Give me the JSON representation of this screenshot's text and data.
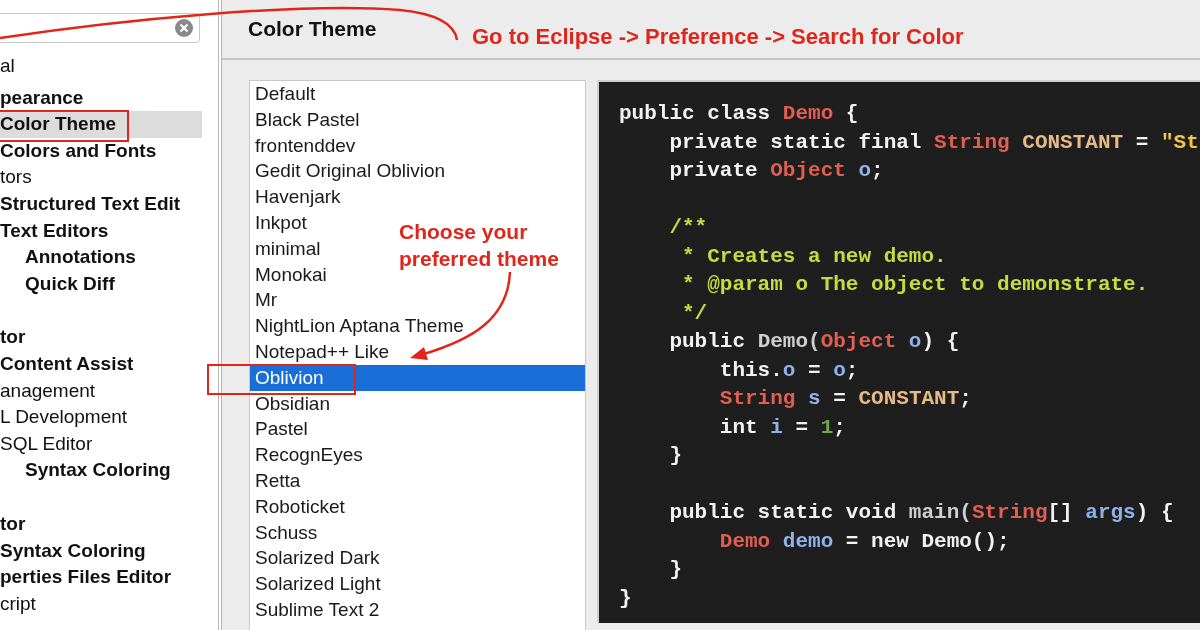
{
  "sidebar": {
    "sections": [
      {
        "items": [
          {
            "label": "al",
            "bold": false,
            "indented": false,
            "selected": false
          }
        ]
      },
      {
        "items": [
          {
            "label": "pearance",
            "bold": true,
            "indented": false,
            "selected": false
          },
          {
            "label": "Color Theme",
            "bold": true,
            "indented": false,
            "selected": true
          },
          {
            "label": "Colors and Fonts",
            "bold": true,
            "indented": false,
            "selected": false
          },
          {
            "label": "tors",
            "bold": false,
            "indented": false,
            "selected": false
          },
          {
            "label": "Structured Text Edit",
            "bold": true,
            "indented": false,
            "selected": false
          },
          {
            "label": "Text Editors",
            "bold": true,
            "indented": false,
            "selected": false
          },
          {
            "label": "Annotations",
            "bold": true,
            "indented": true,
            "selected": false
          },
          {
            "label": "Quick Diff",
            "bold": true,
            "indented": true,
            "selected": false
          }
        ]
      },
      {
        "items": [
          {
            "label": "tor",
            "bold": true,
            "indented": false,
            "selected": false
          },
          {
            "label": "Content Assist",
            "bold": true,
            "indented": false,
            "selected": false
          },
          {
            "label": "anagement",
            "bold": false,
            "indented": false,
            "selected": false
          },
          {
            "label": "L Development",
            "bold": false,
            "indented": false,
            "selected": false
          },
          {
            "label": "SQL Editor",
            "bold": false,
            "indented": false,
            "selected": false
          },
          {
            "label": "Syntax Coloring",
            "bold": true,
            "indented": true,
            "selected": false
          }
        ]
      },
      {
        "items": [
          {
            "label": "tor",
            "bold": true,
            "indented": false,
            "selected": false
          },
          {
            "label": "Syntax Coloring",
            "bold": true,
            "indented": false,
            "selected": false
          },
          {
            "label": "perties Files Editor",
            "bold": true,
            "indented": false,
            "selected": false
          },
          {
            "label": "cript",
            "bold": false,
            "indented": false,
            "selected": false
          }
        ]
      }
    ]
  },
  "page_title": "Color Theme",
  "themes": [
    {
      "label": "Default",
      "selected": false
    },
    {
      "label": "Black Pastel",
      "selected": false
    },
    {
      "label": "frontenddev",
      "selected": false
    },
    {
      "label": "Gedit Original Oblivion",
      "selected": false
    },
    {
      "label": "Havenjark",
      "selected": false
    },
    {
      "label": "Inkpot",
      "selected": false
    },
    {
      "label": "minimal",
      "selected": false
    },
    {
      "label": "Monokai",
      "selected": false
    },
    {
      "label": "Mr",
      "selected": false
    },
    {
      "label": "NightLion Aptana Theme",
      "selected": false
    },
    {
      "label": "Notepad++ Like",
      "selected": false
    },
    {
      "label": "Oblivion",
      "selected": true
    },
    {
      "label": "Obsidian",
      "selected": false
    },
    {
      "label": "Pastel",
      "selected": false
    },
    {
      "label": "RecognEyes",
      "selected": false
    },
    {
      "label": "Retta",
      "selected": false
    },
    {
      "label": "Roboticket",
      "selected": false
    },
    {
      "label": "Schuss",
      "selected": false
    },
    {
      "label": "Solarized Dark",
      "selected": false
    },
    {
      "label": "Solarized Light",
      "selected": false
    },
    {
      "label": "Sublime Text 2",
      "selected": false
    }
  ],
  "code_preview": [
    {
      "kind": "code",
      "tokens": [
        {
          "kind": "keyword",
          "text": "public class "
        },
        {
          "kind": "type",
          "text": "Demo"
        },
        {
          "kind": "keyword",
          "text": " {"
        }
      ]
    },
    {
      "kind": "code",
      "tokens": [
        {
          "kind": "keyword",
          "text": "    private static final "
        },
        {
          "kind": "type",
          "text": "String"
        },
        {
          "kind": "constant",
          "text": " CONSTANT"
        },
        {
          "kind": "keyword",
          "text": " = "
        },
        {
          "kind": "string",
          "text": "\"St"
        }
      ]
    },
    {
      "kind": "code",
      "tokens": [
        {
          "kind": "keyword",
          "text": "    private "
        },
        {
          "kind": "type",
          "text": "Object"
        },
        {
          "kind": "variable",
          "text": " o"
        },
        {
          "kind": "keyword",
          "text": ";"
        }
      ]
    },
    {
      "kind": "blank"
    },
    {
      "kind": "code",
      "tokens": [
        {
          "kind": "comment",
          "text": "    /**"
        }
      ]
    },
    {
      "kind": "code",
      "tokens": [
        {
          "kind": "comment",
          "text": "     * Creates a new demo."
        }
      ]
    },
    {
      "kind": "code",
      "tokens": [
        {
          "kind": "comment",
          "text": "     * @param o The object to demonstrate."
        }
      ]
    },
    {
      "kind": "code",
      "tokens": [
        {
          "kind": "comment",
          "text": "     */"
        }
      ]
    },
    {
      "kind": "code",
      "tokens": [
        {
          "kind": "keyword",
          "text": "    public "
        },
        {
          "kind": "plain",
          "text": "Demo("
        },
        {
          "kind": "type",
          "text": "Object"
        },
        {
          "kind": "variable",
          "text": " o"
        },
        {
          "kind": "keyword",
          "text": ") {"
        }
      ]
    },
    {
      "kind": "code",
      "tokens": [
        {
          "kind": "keyword",
          "text": "        this."
        },
        {
          "kind": "variable",
          "text": "o"
        },
        {
          "kind": "keyword",
          "text": " = "
        },
        {
          "kind": "variable",
          "text": "o"
        },
        {
          "kind": "keyword",
          "text": ";"
        }
      ]
    },
    {
      "kind": "code",
      "tokens": [
        {
          "kind": "type",
          "text": "        String"
        },
        {
          "kind": "variable",
          "text": " s"
        },
        {
          "kind": "keyword",
          "text": " = "
        },
        {
          "kind": "constant",
          "text": "CONSTANT"
        },
        {
          "kind": "keyword",
          "text": ";"
        }
      ]
    },
    {
      "kind": "code",
      "tokens": [
        {
          "kind": "keyword",
          "text": "        int "
        },
        {
          "kind": "variable",
          "text": "i"
        },
        {
          "kind": "keyword",
          "text": " = "
        },
        {
          "kind": "number",
          "text": "1"
        },
        {
          "kind": "keyword",
          "text": ";"
        }
      ]
    },
    {
      "kind": "code",
      "tokens": [
        {
          "kind": "keyword",
          "text": "    }"
        }
      ]
    },
    {
      "kind": "blank"
    },
    {
      "kind": "code",
      "tokens": [
        {
          "kind": "keyword",
          "text": "    public static void "
        },
        {
          "kind": "plain",
          "text": "main("
        },
        {
          "kind": "type",
          "text": "String"
        },
        {
          "kind": "keyword",
          "text": "[] "
        },
        {
          "kind": "variable",
          "text": "args"
        },
        {
          "kind": "keyword",
          "text": ") {"
        }
      ]
    },
    {
      "kind": "code",
      "tokens": [
        {
          "kind": "type",
          "text": "        Demo"
        },
        {
          "kind": "variable",
          "text": " demo"
        },
        {
          "kind": "keyword",
          "text": " = new Demo();"
        }
      ]
    },
    {
      "kind": "code",
      "tokens": [
        {
          "kind": "keyword",
          "text": "    }"
        }
      ]
    },
    {
      "kind": "code",
      "tokens": [
        {
          "kind": "keyword",
          "text": "}"
        }
      ]
    }
  ],
  "annotations": [
    {
      "kind": "top",
      "text": "Go to Eclipse -> Preference -> Search for Color"
    },
    {
      "kind": "middle",
      "text": "Choose your preferred theme"
    }
  ]
}
